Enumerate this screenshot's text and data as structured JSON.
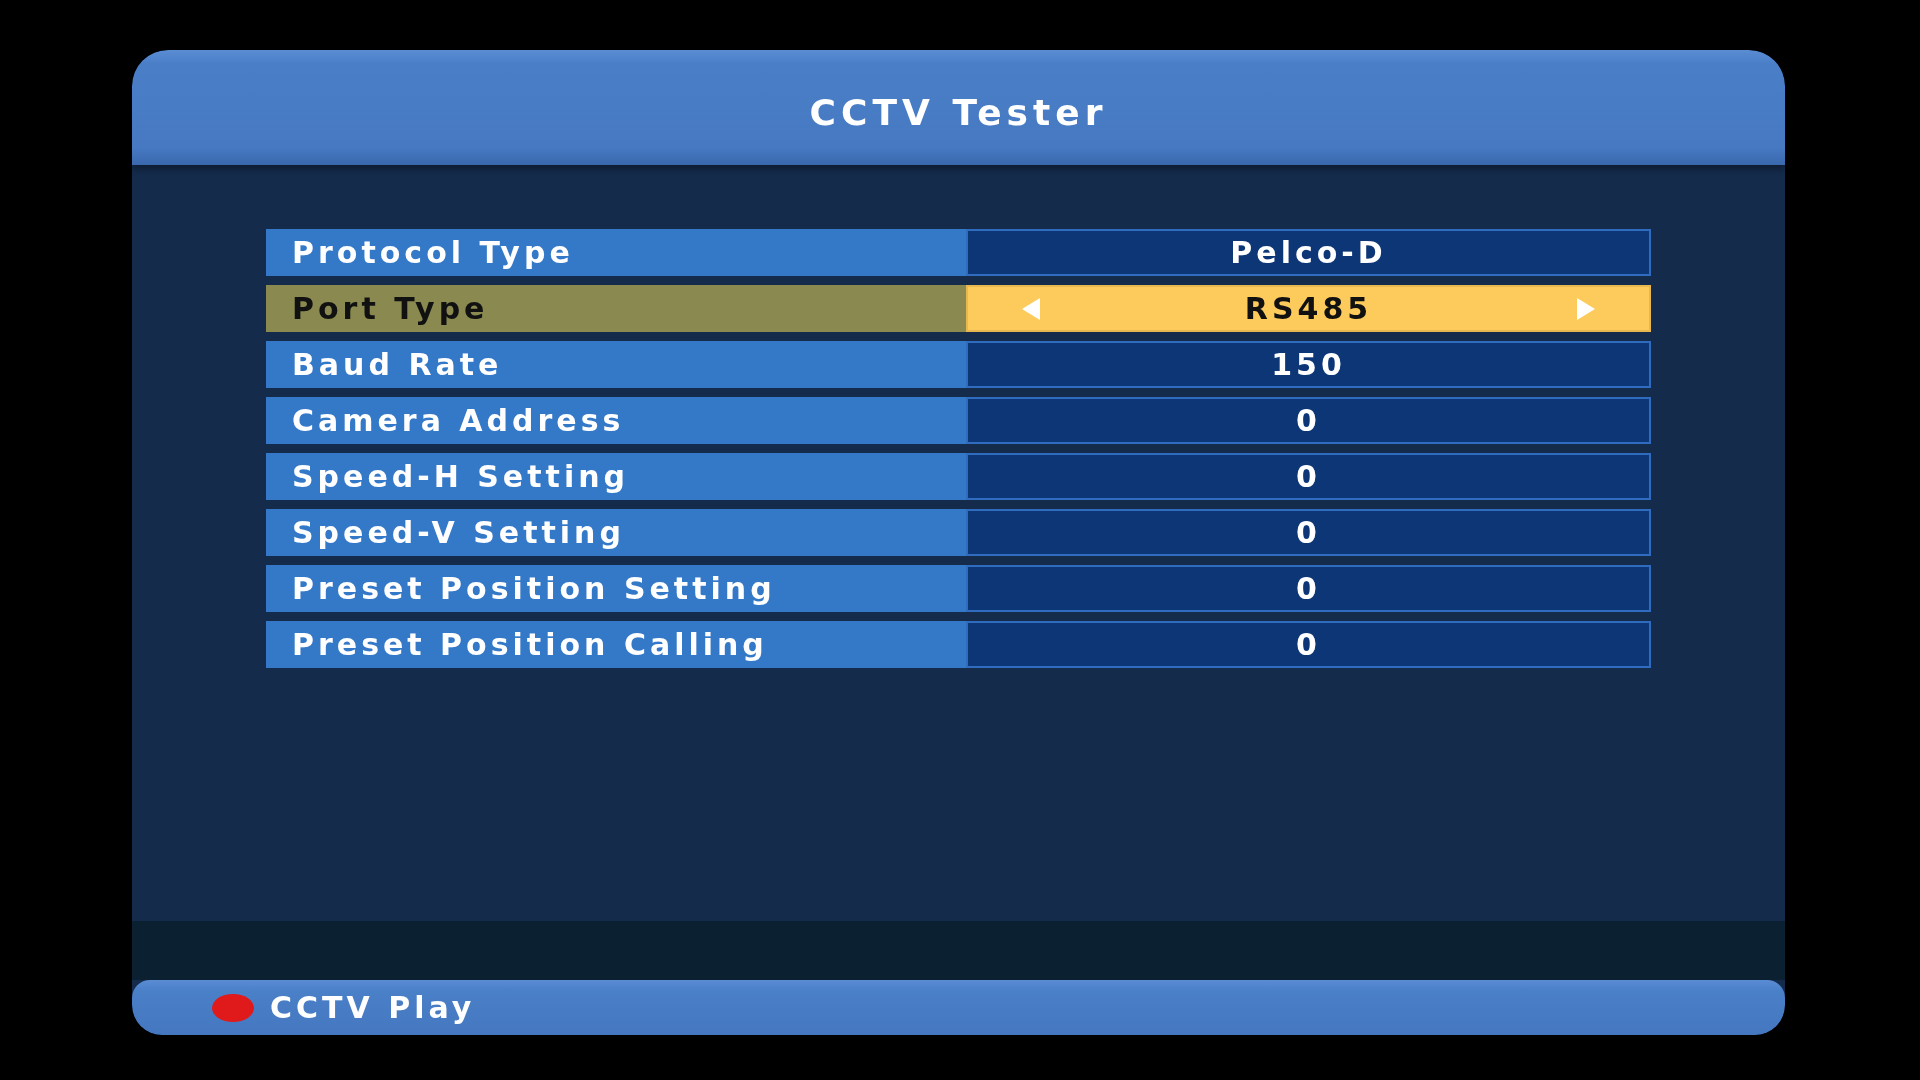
{
  "window": {
    "title": "CCTV Tester"
  },
  "settings": [
    {
      "label": "Protocol Type",
      "value": "Pelco-D",
      "selected": false
    },
    {
      "label": "Port Type",
      "value": "RS485",
      "selected": true
    },
    {
      "label": "Baud Rate",
      "value": "150",
      "selected": false
    },
    {
      "label": "Camera Address",
      "value": "0",
      "selected": false
    },
    {
      "label": "Speed-H Setting",
      "value": "0",
      "selected": false
    },
    {
      "label": "Speed-V Setting",
      "value": "0",
      "selected": false
    },
    {
      "label": "Preset Position Setting",
      "value": "0",
      "selected": false
    },
    {
      "label": "Preset Position Calling",
      "value": "0",
      "selected": false
    }
  ],
  "footer": {
    "hints": [
      {
        "color": "#e01a1a",
        "label": "CCTV Play"
      }
    ]
  }
}
